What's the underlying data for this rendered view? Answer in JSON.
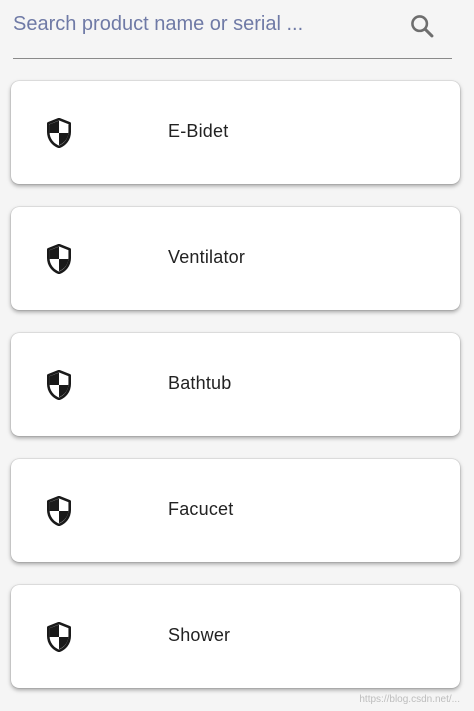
{
  "search": {
    "placeholder": "Search product name or serial ...",
    "value": ""
  },
  "icons": {
    "search": "search-icon",
    "item": "shield-icon"
  },
  "colors": {
    "placeholder": "#6f7aa6",
    "icon": "#1a1a1a",
    "card_bg": "#ffffff",
    "page_bg": "#f5f5f5"
  },
  "products": [
    {
      "label": "E-Bidet"
    },
    {
      "label": "Ventilator"
    },
    {
      "label": "Bathtub"
    },
    {
      "label": "Facucet"
    },
    {
      "label": "Shower"
    }
  ],
  "watermark": "https://blog.csdn.net/..."
}
